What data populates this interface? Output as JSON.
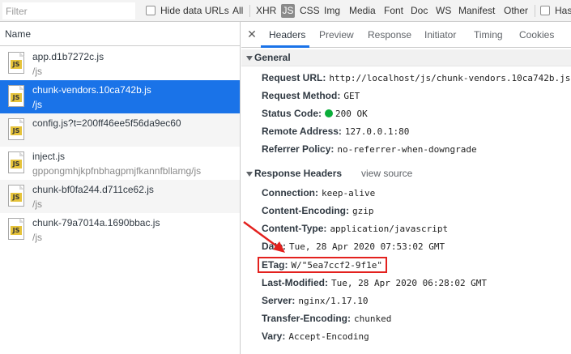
{
  "filter_bar": {
    "filter_placeholder": "Filter",
    "hide_data_urls_label": "Hide data URLs",
    "types": [
      "All",
      "XHR",
      "JS",
      "CSS",
      "Img",
      "Media",
      "Font",
      "Doc",
      "WS",
      "Manifest",
      "Other"
    ],
    "selected_type": "JS",
    "has_label": "Has"
  },
  "request_list": {
    "name_header": "Name",
    "rows": [
      {
        "name": "app.d1b7272c.js",
        "path": "/js",
        "icon": "js-file-icon"
      },
      {
        "name": "chunk-vendors.10ca742b.js",
        "path": "/js",
        "icon": "js-file-icon"
      },
      {
        "name": "config.js?t=200ff46ee5f56da9ec60",
        "path": "",
        "icon": "js-file-icon"
      },
      {
        "name": "inject.js",
        "path": "gppongmhjkpfnbhagpmjfkannfbllamg/js",
        "icon": "js-file-icon"
      },
      {
        "name": "chunk-bf0fa244.d711ce62.js",
        "path": "/js",
        "icon": "js-file-icon"
      },
      {
        "name": "chunk-79a7014a.1690bbac.js",
        "path": "/js",
        "icon": "js-file-icon"
      }
    ],
    "selected_index": 1
  },
  "detail_tabs": {
    "close_icon": "close-icon",
    "tabs": [
      "Headers",
      "Preview",
      "Response",
      "Initiator",
      "Timing",
      "Cookies"
    ],
    "active": "Headers"
  },
  "general": {
    "title": "General",
    "request_url_label": "Request URL:",
    "request_url": "http://localhost/js/chunk-vendors.10ca742b.js",
    "request_method_label": "Request Method:",
    "request_method": "GET",
    "status_code_label": "Status Code:",
    "status_code": "200 OK",
    "remote_address_label": "Remote Address:",
    "remote_address": "127.0.0.1:80",
    "referrer_policy_label": "Referrer Policy:",
    "referrer_policy": "no-referrer-when-downgrade"
  },
  "response_headers": {
    "title": "Response Headers",
    "view_source": "view source",
    "connection_label": "Connection:",
    "connection": "keep-alive",
    "content_encoding_label": "Content-Encoding:",
    "content_encoding": "gzip",
    "content_type_label": "Content-Type:",
    "content_type": "application/javascript",
    "date_label": "Date:",
    "date": "Tue, 28 Apr 2020 07:53:02 GMT",
    "etag_label": "ETag:",
    "etag": "W/\"5ea7ccf2-9f1e\"",
    "last_modified_label": "Last-Modified:",
    "last_modified": "Tue, 28 Apr 2020 06:28:02 GMT",
    "server_label": "Server:",
    "server": "nginx/1.17.10",
    "transfer_encoding_label": "Transfer-Encoding:",
    "transfer_encoding": "chunked",
    "vary_label": "Vary:",
    "vary": "Accept-Encoding"
  },
  "colors": {
    "selected_row": "#1a73e8",
    "status_ok": "#0bae3a",
    "annotation": "#e3211e",
    "js_badge": "#e6c33a"
  }
}
